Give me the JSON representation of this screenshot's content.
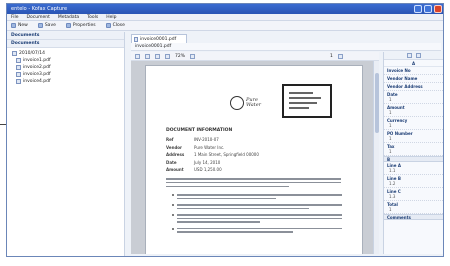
{
  "window": {
    "title": "entelo - Kofax Capture"
  },
  "menu": [
    "File",
    "Document",
    "Metadata",
    "Tools",
    "Help"
  ],
  "toolbar": {
    "new": "New",
    "save": "Save",
    "properties": "Properties",
    "close": "Close"
  },
  "left_panel": {
    "header1": "Documents",
    "header2": "Documents",
    "tree": [
      "2010/07/14",
      "invoice1.pdf",
      "invoice2.pdf",
      "invoice3.pdf",
      "invoice4.pdf"
    ]
  },
  "document_tab": {
    "label": "invoice0001.pdf"
  },
  "filepath": "invoice0001.pdf",
  "view_toolbar": {
    "zoom": "72%",
    "page": "1"
  },
  "page": {
    "logo_text": "Pure\nWater",
    "heading": "DOCUMENT INFORMATION",
    "meta": [
      {
        "k": "Ref",
        "v": "INV-2010-07"
      },
      {
        "k": "Vendor",
        "v": "Pure Water Inc."
      },
      {
        "k": "Address",
        "v": "1 Main Street, Springfield 00000"
      },
      {
        "k": "Date",
        "v": "July 14, 2010"
      },
      {
        "k": "Amount",
        "v": "USD 1,250.00"
      }
    ]
  },
  "right_panel": {
    "heading": "A",
    "fields": [
      {
        "label": "Invoice No",
        "value": ""
      },
      {
        "label": "Vendor Name",
        "value": ""
      },
      {
        "label": "Vendor Address",
        "value": ""
      },
      {
        "label": "Date",
        "value": "1"
      },
      {
        "label": "Amount",
        "value": "1"
      },
      {
        "label": "Currency",
        "value": "1"
      },
      {
        "label": "PO Number",
        "value": "1"
      },
      {
        "label": "Tax",
        "value": "1"
      }
    ],
    "section1": "B",
    "fields2": [
      {
        "label": "Line A",
        "value": "1.1"
      },
      {
        "label": "Line B",
        "value": "1.2"
      },
      {
        "label": "Line C",
        "value": "1.3"
      },
      {
        "label": "Total",
        "value": "1"
      }
    ],
    "section2": "Comments"
  }
}
